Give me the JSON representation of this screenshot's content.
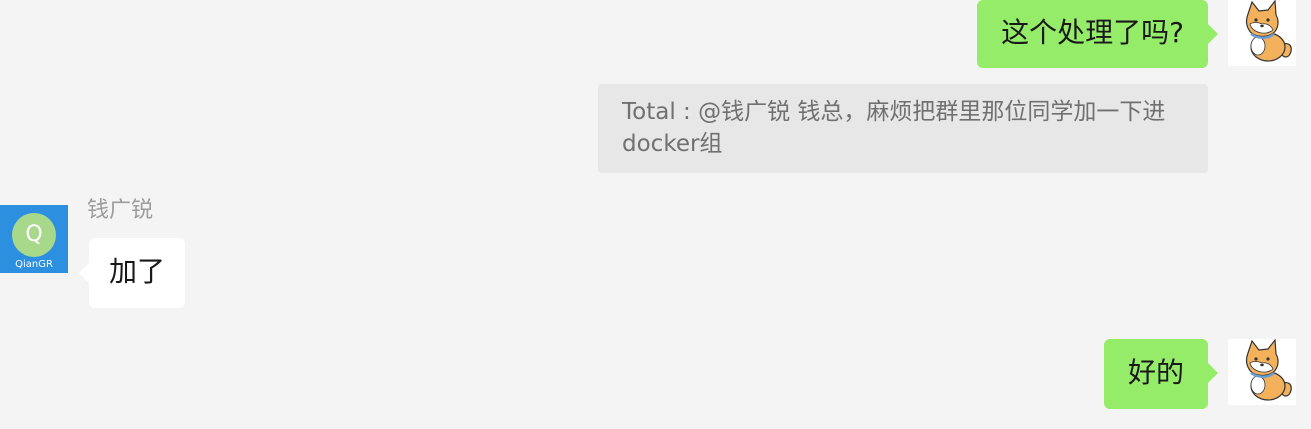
{
  "messages": [
    {
      "sender": "self",
      "text": "这个处理了吗?"
    },
    {
      "sender": "self-quote",
      "text": "Total : @钱广锐 钱总，麻烦把群里那位同学加一下进docker组"
    },
    {
      "sender": "other",
      "name": "钱广锐",
      "avatar_letter": "Q",
      "avatar_tag": "QianGR",
      "text": "加了"
    },
    {
      "sender": "self",
      "text": "好的"
    }
  ],
  "colors": {
    "self_bubble": "#95ec69",
    "other_bubble": "#ffffff",
    "background": "#f4f4f4",
    "quote_bg": "#e7e7e7",
    "other_avatar": "#2c8fe0"
  },
  "icons": {
    "self_avatar": "shiba-dog-avatar-icon"
  }
}
